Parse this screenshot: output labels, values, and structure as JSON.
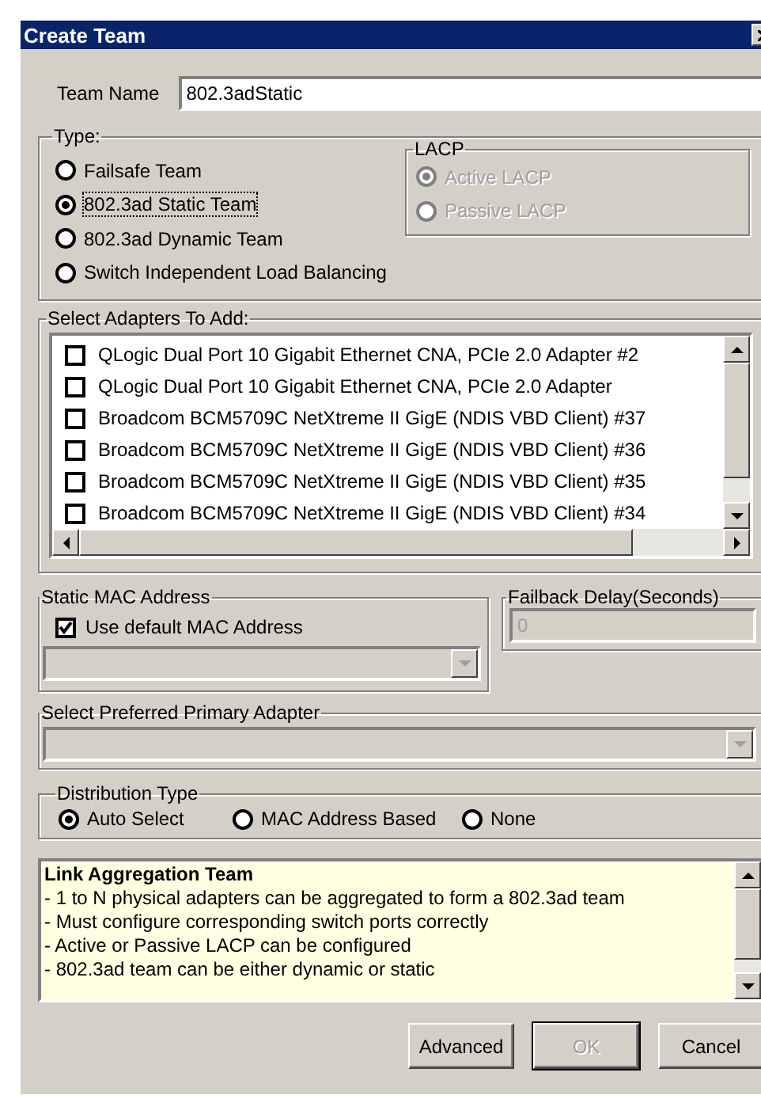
{
  "window": {
    "title": "Create Team"
  },
  "team_name": {
    "label": "Team Name",
    "value": "802.3adStatic"
  },
  "type_group": {
    "label": "Type:",
    "options": [
      {
        "label": "Failsafe Team",
        "selected": false,
        "focused": false
      },
      {
        "label": "802.3ad Static Team",
        "selected": true,
        "focused": true
      },
      {
        "label": "802.3ad Dynamic Team",
        "selected": false,
        "focused": false
      },
      {
        "label": "Switch Independent Load Balancing",
        "selected": false,
        "focused": false
      }
    ]
  },
  "lacp": {
    "label": "LACP",
    "disabled": true,
    "options": [
      {
        "label": "Active LACP",
        "selected": true
      },
      {
        "label": "Passive LACP",
        "selected": false
      }
    ]
  },
  "adapters": {
    "label": "Select Adapters To Add:",
    "items": [
      {
        "label": "QLogic Dual Port 10 Gigabit Ethernet CNA, PCIe 2.0 Adapter #2",
        "checked": false
      },
      {
        "label": "QLogic Dual Port 10 Gigabit Ethernet CNA, PCIe 2.0 Adapter",
        "checked": false
      },
      {
        "label": "Broadcom BCM5709C NetXtreme II GigE (NDIS VBD Client) #37",
        "checked": false
      },
      {
        "label": "Broadcom BCM5709C NetXtreme II GigE (NDIS VBD Client) #36",
        "checked": false
      },
      {
        "label": "Broadcom BCM5709C NetXtreme II GigE (NDIS VBD Client) #35",
        "checked": false
      },
      {
        "label": "Broadcom BCM5709C NetXtreme II GigE (NDIS VBD Client) #34",
        "checked": false
      }
    ]
  },
  "static_mac": {
    "label": "Static MAC Address",
    "checkbox": {
      "label": "Use default MAC Address",
      "checked": true
    },
    "combo": {
      "disabled": true
    }
  },
  "failback": {
    "label": "Failback Delay(Seconds)",
    "field": {
      "value": "0",
      "disabled": true
    }
  },
  "primary_adapter": {
    "label": "Select Preferred Primary Adapter",
    "combo": {
      "disabled": true
    }
  },
  "distribution": {
    "label": "Distribution Type",
    "options": [
      {
        "label": "Auto Select",
        "selected": true
      },
      {
        "label": "MAC Address Based",
        "selected": false
      },
      {
        "label": "None",
        "selected": false
      }
    ]
  },
  "info": {
    "title": "Link Aggregation Team",
    "lines": [
      "- 1 to N physical adapters can be aggregated to form a 802.3ad team",
      "- Must configure corresponding switch ports correctly",
      "- Active or Passive LACP can be configured",
      "- 802.3ad team can be either dynamic or static"
    ]
  },
  "buttons": [
    {
      "label": "Advanced",
      "disabled": false,
      "default": false
    },
    {
      "label": "OK",
      "disabled": true,
      "default": true
    },
    {
      "label": "Cancel",
      "disabled": false,
      "default": false
    }
  ]
}
